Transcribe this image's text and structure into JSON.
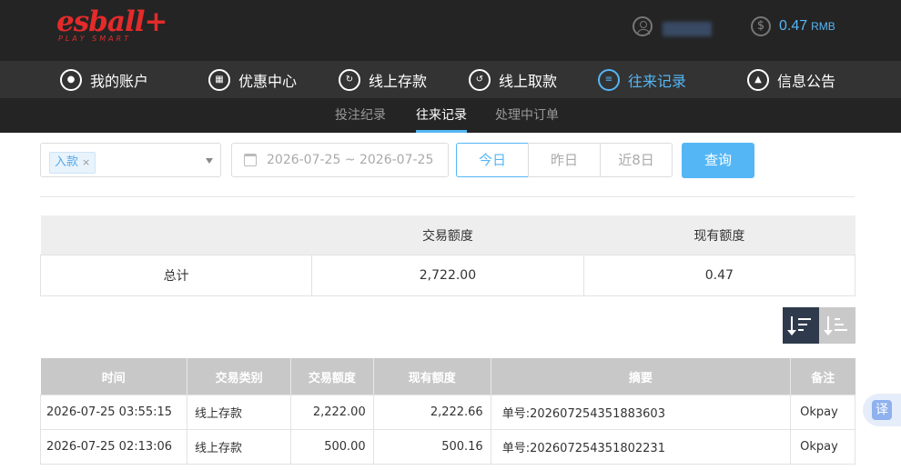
{
  "header": {
    "logo_text": "esball+",
    "logo_tagline": "PLAY SMART",
    "balance_value": "0.47",
    "balance_unit": "RMB",
    "coin_symbol": "$"
  },
  "nav": {
    "items": [
      {
        "label": "我的账户",
        "icon": "user-icon"
      },
      {
        "label": "优惠中心",
        "icon": "gift-icon"
      },
      {
        "label": "线上存款",
        "icon": "deposit-icon"
      },
      {
        "label": "线上取款",
        "icon": "withdraw-icon"
      },
      {
        "label": "往来记录",
        "icon": "records-icon",
        "active": true
      },
      {
        "label": "信息公告",
        "icon": "bell-icon"
      }
    ]
  },
  "subnav": {
    "items": [
      "投注纪录",
      "往来记录",
      "处理中订单"
    ],
    "active": "往来记录"
  },
  "filters": {
    "type_tag": "入款",
    "tag_remove": "×",
    "date_range": "2026-07-25 ~ 2026-07-25",
    "quick_dates": [
      "今日",
      "昨日",
      "近8日"
    ],
    "active_quick_date": "今日",
    "query_label": "查询"
  },
  "summary": {
    "headers": [
      "",
      "交易额度",
      "现有额度"
    ],
    "row": {
      "label": "总计",
      "amount": "2,722.00",
      "current": "0.47"
    }
  },
  "records": {
    "headers": [
      "时间",
      "交易类别",
      "交易额度",
      "现有额度",
      "摘要",
      "备注"
    ],
    "rows": [
      {
        "time": "2026-07-25 03:55:15",
        "type": "线上存款",
        "amount": "2,222.00",
        "balance": "2,222.66",
        "summary": "单号:202607254351883603",
        "note": "Okpay"
      },
      {
        "time": "2026-07-25 02:13:06",
        "type": "线上存款",
        "amount": "500.00",
        "balance": "500.16",
        "summary": "单号:202607254351802231",
        "note": "Okpay"
      }
    ]
  },
  "colors": {
    "accent": "#55b6f5",
    "logo": "#e32b2b",
    "header_bg": "#242424",
    "nav_bg": "#333333"
  },
  "translate_label": "译"
}
